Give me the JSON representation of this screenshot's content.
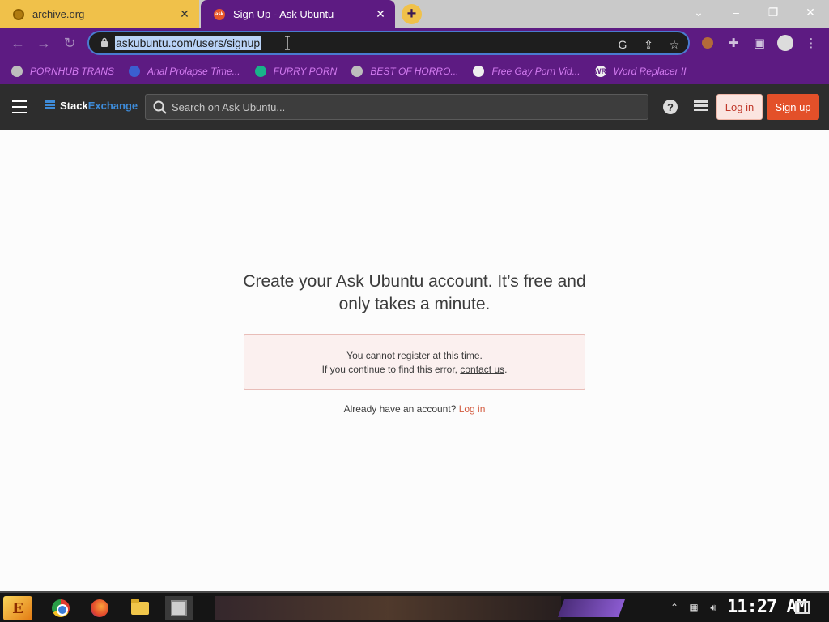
{
  "browser": {
    "tabs": [
      {
        "title": "archive.org",
        "active": false
      },
      {
        "title": "Sign Up - Ask Ubuntu",
        "active": true,
        "favicon_text": "ask"
      }
    ],
    "new_tab_label": "+",
    "url": "askubuntu.com/users/signup",
    "bookmarks": [
      {
        "label": "PORNHUB TRANS",
        "icon": "globe-icon"
      },
      {
        "label": "Anal Prolapse Time...",
        "icon": "bookmark-icon"
      },
      {
        "label": "FURRY PORN",
        "icon": "bookmark-icon"
      },
      {
        "label": "BEST OF HORRO...",
        "icon": "globe-icon"
      },
      {
        "label": "Free Gay Porn Vid...",
        "icon": "bookmark-icon"
      },
      {
        "label": "Word Replacer II",
        "icon": "extension-icon",
        "icon_text": "WR"
      }
    ],
    "colors": {
      "frame": "#5d1b82",
      "tab_inactive": "#f0c14a",
      "bookmark_text": "#d37bf0"
    }
  },
  "site": {
    "logo_part1": "Stack",
    "logo_part2": "Exchange",
    "search_placeholder": "Search on Ask Ubuntu...",
    "help_label": "?",
    "login_button": "Log in",
    "signup_button": "Sign up",
    "colors": {
      "topbar": "#2d2d2d",
      "accent": "#e35029"
    }
  },
  "main": {
    "headline": "Create your Ask Ubuntu account. It’s free and only takes a minute.",
    "notice_line1": "You cannot register at this time.",
    "notice_line2_prefix": "If you continue to find this error, ",
    "notice_link": "contact us",
    "notice_line2_suffix": ".",
    "already_text": "Already have an account? ",
    "already_link": "Log in"
  },
  "taskbar": {
    "start_label": "E",
    "clock": "11:27 AM"
  }
}
